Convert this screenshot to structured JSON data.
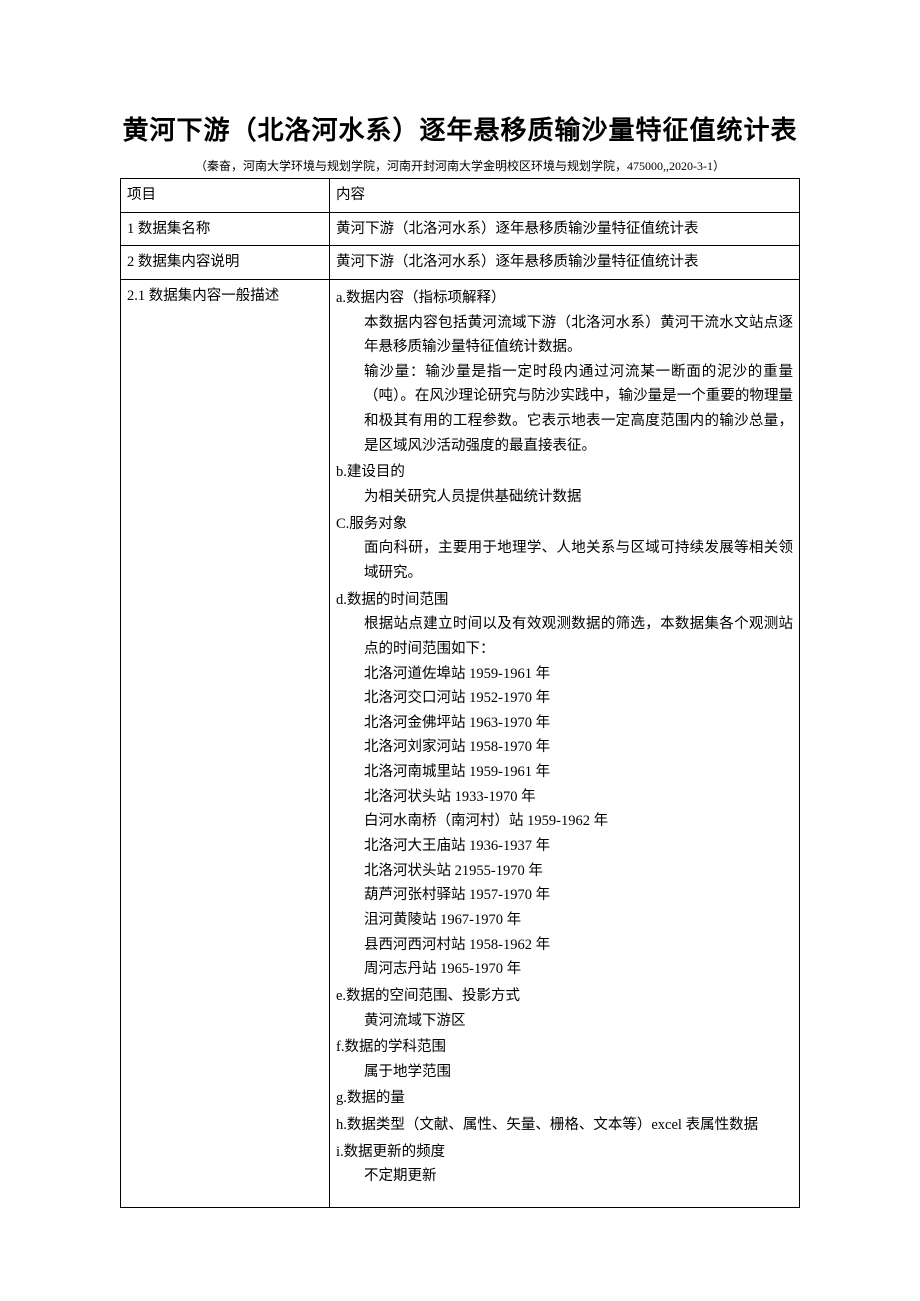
{
  "title": "黄河下游（北洛河水系）逐年悬移质输沙量特征值统计表",
  "subtitle": "（秦奋，河南大学环境与规划学院，河南开封河南大学金明校区环境与规划学院，475000,,2020-3-1）",
  "header": {
    "left": "项目",
    "right": "内容"
  },
  "rows": {
    "r1": {
      "label": "1 数据集名称",
      "content": "黄河下游（北洛河水系）逐年悬移质输沙量特征值统计表"
    },
    "r2": {
      "label": "2 数据集内容说明",
      "content": "黄河下游（北洛河水系）逐年悬移质输沙量特征值统计表"
    },
    "r21": {
      "label": "2.1 数据集内容一般描述",
      "a_label": "a.数据内容（指标项解释）",
      "a_p1": "本数据内容包括黄河流域下游（北洛河水系）黄河干流水文站点逐年悬移质输沙量特征值统计数据。",
      "a_p2": "输沙量：输沙量是指一定时段内通过河流某一断面的泥沙的重量（吨）。在风沙理论研究与防沙实践中，输沙量是一个重要的物理量和极其有用的工程参数。它表示地表一定高度范围内的输沙总量，是区域风沙活动强度的最直接表征。",
      "b_label": "b.建设目的",
      "b_p": "为相关研究人员提供基础统计数据",
      "c_label": "C.服务对象",
      "c_p": "面向科研，主要用于地理学、人地关系与区域可持续发展等相关领域研究。",
      "d_label": "d.数据的时间范围",
      "d_intro": "根据站点建立时间以及有效观测数据的筛选，本数据集各个观测站点的时间范围如下：",
      "stations": [
        "北洛河道佐埠站 1959-1961 年",
        "北洛河交口河站 1952-1970 年",
        "北洛河金佛坪站 1963-1970 年",
        "北洛河刘家河站 1958-1970 年",
        "北洛河南城里站 1959-1961 年",
        "北洛河状头站 1933-1970 年",
        "白河水南桥（南河村）站 1959-1962 年",
        "北洛河大王庙站 1936-1937 年",
        "北洛河状头站 21955-1970 年",
        "葫芦河张村驿站 1957-1970 年",
        "沮河黄陵站 1967-1970 年",
        "县西河西河村站 1958-1962 年",
        "周河志丹站 1965-1970 年"
      ],
      "e_label": "e.数据的空间范围、投影方式",
      "e_p": "黄河流域下游区",
      "f_label": "f.数据的学科范围",
      "f_p": "属于地学范围",
      "g_label": "g.数据的量",
      "h_label": "h.数据类型（文献、属性、矢量、栅格、文本等）excel 表属性数据",
      "i_label": "i.数据更新的频度",
      "i_p": "不定期更新"
    }
  }
}
